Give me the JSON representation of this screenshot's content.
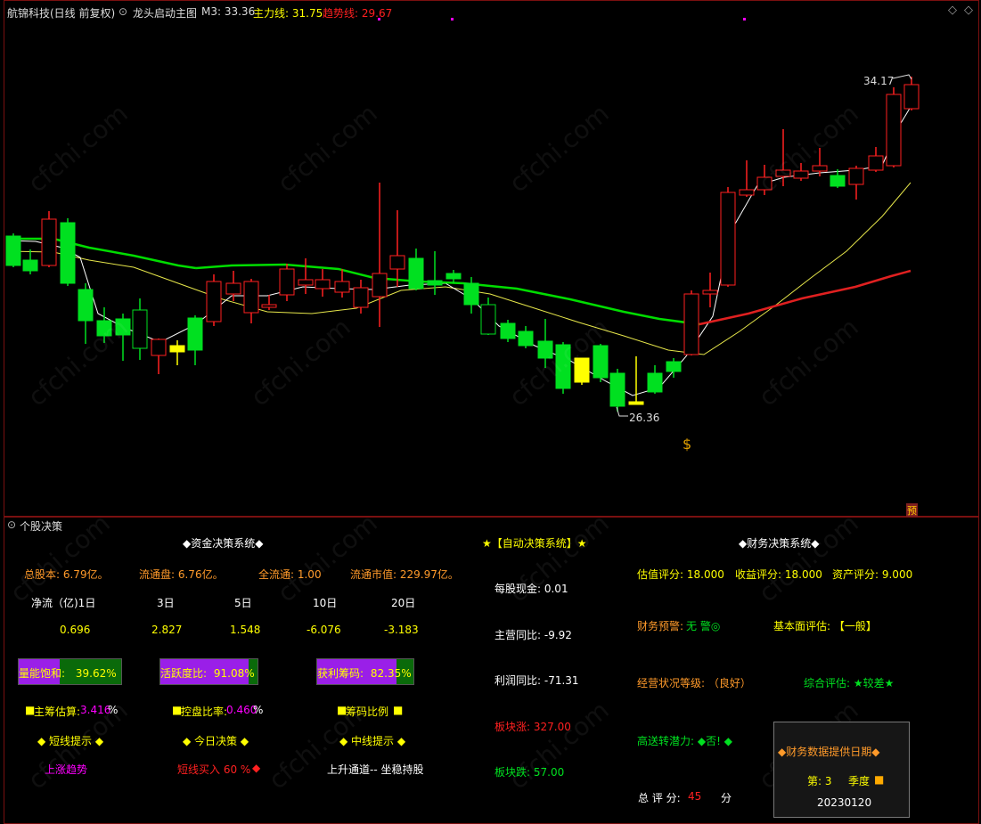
{
  "header": {
    "stock": "航锦科技(日线 前复权)",
    "indicator": "龙头启动主图",
    "m3": "M3: 33.36",
    "zhuli": "主力线: 31.75",
    "qushi": "趋势线: 29.67"
  },
  "chart": {
    "high_label": "34.17",
    "low_label": "26.36",
    "corner_badge": "预",
    "money_icon": "money-bag-icon",
    "colors": {
      "up": "#ff2020",
      "down": "#00e020",
      "doji": "#ffff00",
      "white_line": "#ffffff",
      "yellow_line": "#e6e64a",
      "trend_green": "#00dd00",
      "trend_red": "#e02020"
    }
  },
  "panel": {
    "title": "个股决策",
    "watermark": "cfchi.com",
    "fund": {
      "title": "◆资金决策系统◆",
      "total_shares": "总股本: 6.79亿。",
      "float_shares": "流通盘: 6.76亿。",
      "full_float": "全流通: 1.00",
      "float_mv": "流通市值: 229.97亿。",
      "net_label": "净流（亿)1日",
      "periods": [
        "3日",
        "5日",
        "10日",
        "20日"
      ],
      "values": [
        "0.696",
        "2.827",
        "1.548",
        "-6.076",
        "-3.183"
      ],
      "bars": [
        {
          "label": "量能饱和:",
          "value": "39.62%",
          "fill": 0.3962
        },
        {
          "label": "活跃度比:",
          "value": "91.08%",
          "fill": 0.9108
        },
        {
          "label": "获利筹码:",
          "value": "82.35%",
          "fill": 0.8235
        }
      ],
      "main_est": "主筹估算:",
      "main_est_val": "3.416",
      "main_est_unit": "%",
      "control": "控盘比率:",
      "control_val": "0.460",
      "control_unit": "%",
      "chip": "筹码比例",
      "short_title": "◆ 短线提示 ◆",
      "today_title": "◆ 今日决策 ◆",
      "mid_title": "◆ 中线提示 ◆",
      "short_val": "上涨趋势",
      "today_val": "短线买入 60 %",
      "mid_val": "上升通道-- 坐稳持股"
    },
    "auto": {
      "title": "★【自动决策系统】★",
      "cash": "每股现金: 0.01",
      "rev": "主营同比: -9.92",
      "profit": "利润同比: -71.31",
      "sector_up": "板块涨: 327.00",
      "sector_down": "板块跌: 57.00"
    },
    "fin": {
      "title": "◆财务决策系统◆",
      "val_score": "估值评分: 18.000",
      "inc_score": "收益评分: 18.000",
      "asset_score": "资产评分: 9.000",
      "warn": "财务预警:",
      "warn_val": "无 警◎",
      "fund_eval": "基本面评估: 【一般】",
      "ops": "经营状况等级: （良好）",
      "overall": "综合评估: ★较差★",
      "transfer": "高送转潜力: ◆否! ◆",
      "total": "总 评 分:",
      "total_val": "45",
      "total_unit": "分",
      "box_title": "◆财务数据提供日期◆",
      "box_quarter": "第: 3",
      "box_quarter_unit": "季度",
      "box_date": "20230120"
    }
  }
}
